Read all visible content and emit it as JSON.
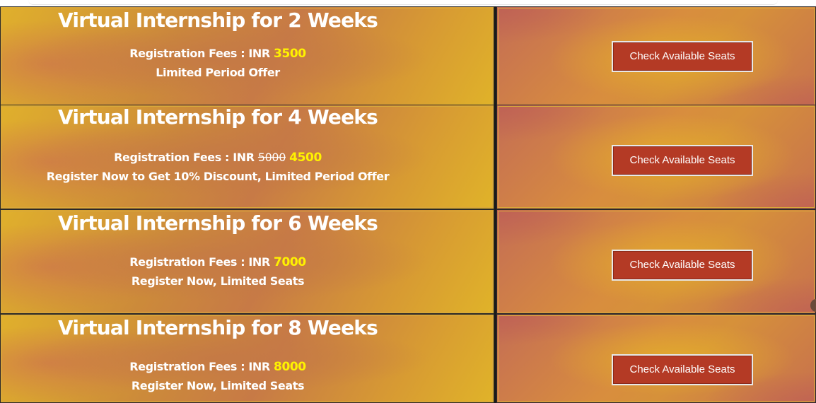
{
  "plans": [
    {
      "title": "Virtual Internship for 2 Weeks",
      "fee_label": "Registration Fees : INR ",
      "old_price": "",
      "price": "3500",
      "note": "Limited Period Offer",
      "button_label": "Check Available Seats"
    },
    {
      "title": "Virtual Internship for 4 Weeks",
      "fee_label": "Registration Fees : INR ",
      "old_price": "5000",
      "price": "4500",
      "note": "Register Now to Get 10% Discount, Limited Period Offer",
      "button_label": "Check Available Seats"
    },
    {
      "title": "Virtual Internship for 6 Weeks",
      "fee_label": "Registration Fees : INR ",
      "old_price": "",
      "price": "7000",
      "note": "Register Now, Limited Seats",
      "button_label": "Check Available Seats"
    },
    {
      "title": "Virtual Internship for 8 Weeks",
      "fee_label": "Registration Fees : INR ",
      "old_price": "",
      "price": "8000",
      "note": "Register Now, Limited Seats",
      "button_label": "Check Available Seats"
    }
  ],
  "colors": {
    "price": "#fff200",
    "button_bg": "#b43a25",
    "text": "#ffffff"
  }
}
